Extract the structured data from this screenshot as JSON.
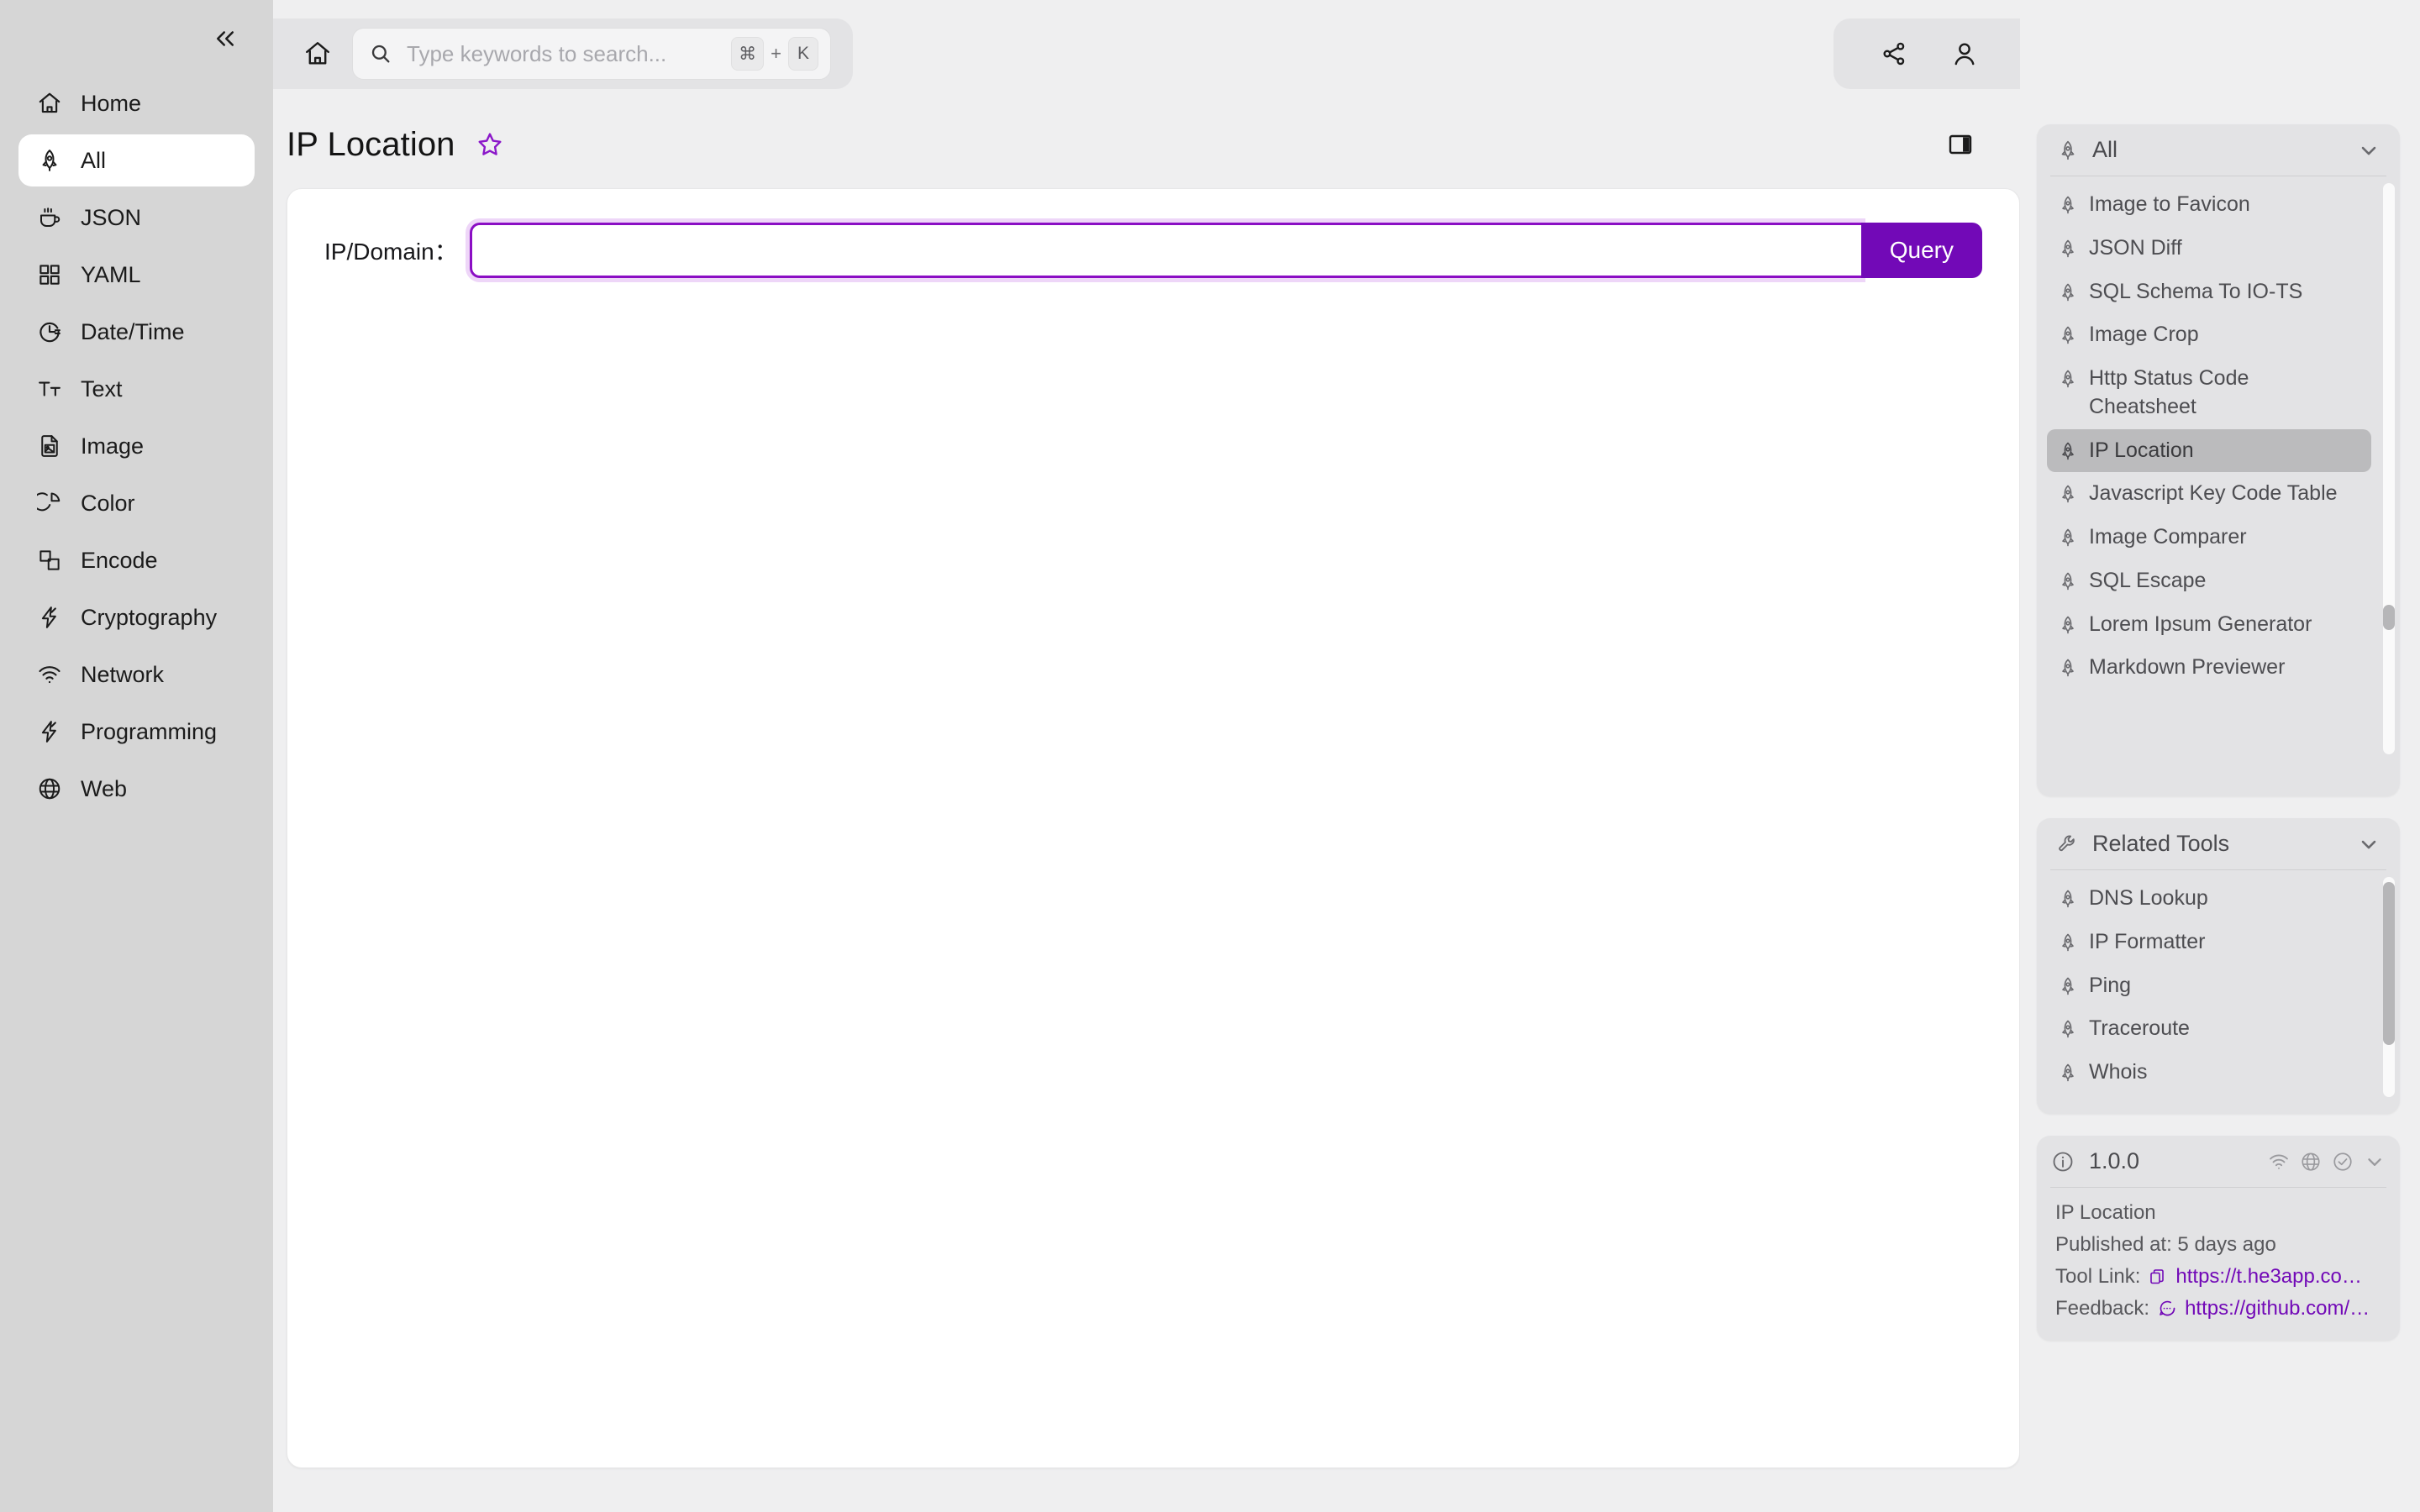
{
  "sidebar": {
    "collapse_label": "collapse",
    "items": [
      {
        "label": "Home",
        "icon": "home-icon"
      },
      {
        "label": "All",
        "icon": "rocket-icon"
      },
      {
        "label": "JSON",
        "icon": "coffee-cup-icon"
      },
      {
        "label": "YAML",
        "icon": "grid-icon"
      },
      {
        "label": "Date/Time",
        "icon": "clock-icon"
      },
      {
        "label": "Text",
        "icon": "text-size-icon"
      },
      {
        "label": "Image",
        "icon": "image-file-icon"
      },
      {
        "label": "Color",
        "icon": "pie-chart-icon"
      },
      {
        "label": "Encode",
        "icon": "copy-layers-icon"
      },
      {
        "label": "Cryptography",
        "icon": "lightning-icon"
      },
      {
        "label": "Network",
        "icon": "wifi-icon"
      },
      {
        "label": "Programming",
        "icon": "lightning-icon"
      },
      {
        "label": "Web",
        "icon": "globe-icon"
      }
    ],
    "active_index": 1
  },
  "topbar": {
    "home_icon": "home-icon",
    "search": {
      "placeholder": "Type keywords to search...",
      "value": "",
      "icon": "search-icon",
      "shortcut_key": "⌘",
      "shortcut_plus": "+",
      "shortcut_letter": "K"
    },
    "share_icon": "share-icon",
    "account_icon": "user-icon"
  },
  "page": {
    "title": "IP Location",
    "favorite_icon": "star-outline-icon",
    "panel_toggle_icon": "right-panel-toggle-icon"
  },
  "form": {
    "field_label": "IP/Domain：",
    "input_value": "",
    "input_placeholder": "",
    "query_label": "Query",
    "accent_color": "#7209b7"
  },
  "rail": {
    "all_panel": {
      "title": "All",
      "icon": "rocket-icon",
      "chevron": "chevron-down-icon",
      "selected": "IP Location",
      "items": [
        "Image to Favicon",
        "JSON Diff",
        "SQL Schema To IO-TS",
        "Image Crop",
        "Http Status Code Cheatsheet",
        "IP Location",
        "Javascript Key Code Table",
        "Image Comparer",
        "SQL Escape",
        "Lorem Ipsum Generator",
        "Markdown Previewer"
      ]
    },
    "related_panel": {
      "title": "Related Tools",
      "icon": "wrench-icon",
      "chevron": "chevron-down-icon",
      "items": [
        "DNS Lookup",
        "IP Formatter",
        "Ping",
        "Traceroute",
        "Whois"
      ]
    },
    "version_panel": {
      "info_icon": "info-circle-icon",
      "version": "1.0.0",
      "status_icons": [
        "wifi-icon",
        "globe-icon",
        "check-circle-icon",
        "chevron-down-icon"
      ],
      "tool_name": "IP Location",
      "published": "Published at: 5 days ago",
      "tool_link_label": "Tool Link:",
      "tool_link_icon": "copy-icon",
      "tool_link": "https://t.he3app.co…",
      "feedback_label": "Feedback:",
      "feedback_icon": "comment-icon",
      "feedback_link": "https://github.com/…"
    }
  }
}
